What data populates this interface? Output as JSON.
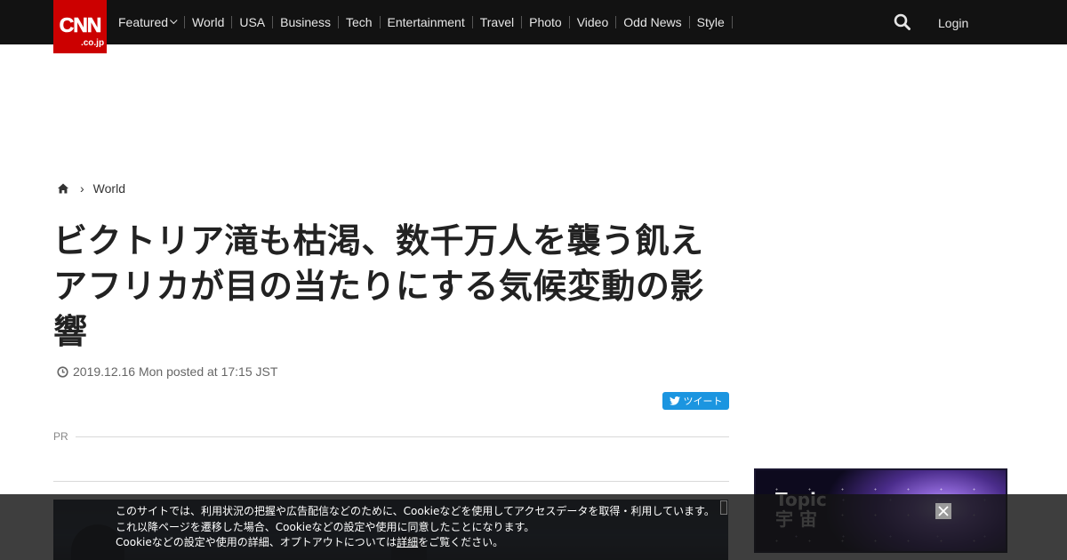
{
  "logo": {
    "text": "CNN",
    "sub": ".co.jp"
  },
  "nav": {
    "items": [
      "Featured",
      "World",
      "USA",
      "Business",
      "Tech",
      "Entertainment",
      "Travel",
      "Photo",
      "Video",
      "Odd News",
      "Style"
    ],
    "login": "Login"
  },
  "breadcrumb": {
    "section": "World"
  },
  "article": {
    "title": "ビクトリア滝も枯渇、数千万人を襲う飢え　アフリカが目の当たりにする気候変動の影響",
    "date": "2019.12.16 Mon posted at 17:15 JST",
    "tweet_label": "ツイート",
    "pr_label": "PR"
  },
  "topic": {
    "line1": "Topic",
    "line2": "宇 宙"
  },
  "cookie": {
    "line1": "このサイトでは、利用状況の把握や広告配信などのために、Cookieなどを使用してアクセスデータを取得・利用しています。",
    "line2": "これ以降ページを遷移した場合、Cookieなどの設定や使用に同意したことになります。",
    "line3_pre": "Cookieなどの設定や使用の詳細、オプトアウトについては",
    "line3_link": "詳細",
    "line3_post": "をご覧ください。"
  },
  "colors": {
    "brand": "#cc0000",
    "nav_bg": "#121212",
    "tweet": "#1b95e0"
  }
}
